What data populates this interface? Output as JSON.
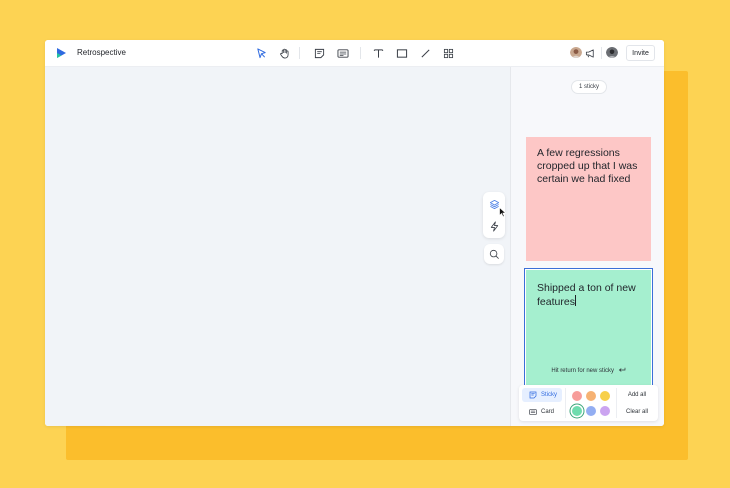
{
  "app": {
    "board_title": "Retrospective",
    "invite_label": "Invite"
  },
  "toolbar": {
    "tools": [
      "select-tool",
      "hand-tool",
      "sticky-tool",
      "card-tool",
      "text-tool",
      "rectangle-tool",
      "line-tool",
      "grid-tool"
    ],
    "active_tool": "select-tool"
  },
  "panel": {
    "sticky_count": "1 sticky",
    "stickies": [
      {
        "text": "A few regressions cropped up that I was certain we had fixed",
        "color": "#fdc7c6"
      },
      {
        "text": "Shipped a ton of new features",
        "color": "#a5efcf",
        "editing": true
      }
    ],
    "hint": "Hit return for new sticky",
    "types": [
      {
        "label": "Sticky",
        "active": true
      },
      {
        "label": "Card",
        "active": false
      }
    ],
    "swatches": [
      "#f79d9a",
      "#f6b273",
      "#f7d04a",
      "#6fdcae",
      "#93aef2",
      "#cba4f0"
    ],
    "selected_swatch": "#6fdcae",
    "add_all_label": "Add all",
    "clear_all_label": "Clear all"
  },
  "colors": {
    "background": "#fdd353",
    "accent": "#3b6fd8",
    "canvas": "#f1f4f8"
  }
}
